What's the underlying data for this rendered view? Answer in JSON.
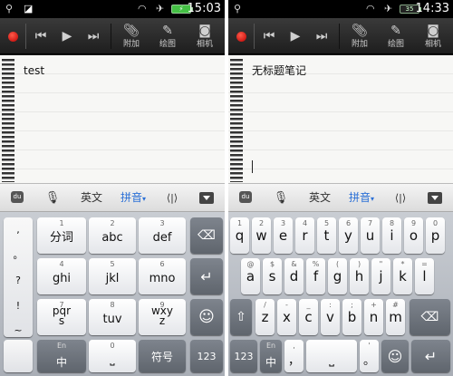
{
  "left_screen": {
    "status": {
      "time": "15:03",
      "icons": [
        "usb-icon",
        "debug-icon",
        "wifi-icon",
        "airplane-icon",
        "battery-full-icon"
      ]
    },
    "toolbar": {
      "attach_label": "附加",
      "draw_label": "绘图",
      "camera_label": "相机"
    },
    "note": {
      "text": "test"
    },
    "ime_bar": {
      "english": "英文",
      "pinyin": "拼音",
      "pinyin_caret": "▾",
      "cursor_glyph": "⟨|⟩"
    },
    "keyboard": {
      "layout": "nine-key",
      "left_column": [
        ",",
        "。",
        "?",
        "!",
        "~"
      ],
      "keys": [
        {
          "sup": "1",
          "main": "分词"
        },
        {
          "sup": "2",
          "main": "abc"
        },
        {
          "sup": "3",
          "main": "def"
        },
        {
          "sup": "4",
          "main": "ghi"
        },
        {
          "sup": "5",
          "main": "jkl"
        },
        {
          "sup": "6",
          "main": "mno"
        },
        {
          "sup": "7",
          "main": "pqr\ns"
        },
        {
          "sup": "8",
          "main": "tuv"
        },
        {
          "sup": "9",
          "main": "wxy\nz"
        }
      ],
      "lang_key": {
        "sup": "En",
        "main": "中"
      },
      "space_key": {
        "sup": "0",
        "main": "⎵"
      },
      "symbol_key": "符号",
      "number_key": "123"
    }
  },
  "right_screen": {
    "status": {
      "time": "14:33",
      "battery_percent": "35",
      "icons": [
        "usb-icon",
        "wifi-icon",
        "airplane-icon",
        "battery-icon"
      ]
    },
    "toolbar": {
      "attach_label": "附加",
      "draw_label": "绘图",
      "camera_label": "相机"
    },
    "note": {
      "text": "无标题笔记"
    },
    "ime_bar": {
      "english": "英文",
      "pinyin": "拼音",
      "pinyin_caret": "▾",
      "cursor_glyph": "⟨|⟩"
    },
    "keyboard": {
      "layout": "qwerty",
      "rows": [
        [
          {
            "sup": "1",
            "main": "q"
          },
          {
            "sup": "2",
            "main": "w"
          },
          {
            "sup": "3",
            "main": "e"
          },
          {
            "sup": "4",
            "main": "r"
          },
          {
            "sup": "5",
            "main": "t"
          },
          {
            "sup": "6",
            "main": "y"
          },
          {
            "sup": "7",
            "main": "u"
          },
          {
            "sup": "8",
            "main": "i"
          },
          {
            "sup": "9",
            "main": "o"
          },
          {
            "sup": "0",
            "main": "p"
          }
        ],
        [
          {
            "sup": "@",
            "main": "a"
          },
          {
            "sup": "$",
            "main": "s"
          },
          {
            "sup": "&",
            "main": "d"
          },
          {
            "sup": "%",
            "main": "f"
          },
          {
            "sup": "(",
            "main": "g"
          },
          {
            "sup": ")",
            "main": "h"
          },
          {
            "sup": "\"",
            "main": "j"
          },
          {
            "sup": "*",
            "main": "k"
          },
          {
            "sup": "=",
            "main": "l"
          }
        ],
        [
          {
            "sup": "/",
            "main": "z"
          },
          {
            "sup": "-",
            "main": "x"
          },
          {
            "sup": "_",
            "main": "c"
          },
          {
            "sup": ":",
            "main": "v"
          },
          {
            "sup": ";",
            "main": "b"
          },
          {
            "sup": "+",
            "main": "n"
          },
          {
            "sup": "#",
            "main": "m"
          }
        ]
      ],
      "comma_key": {
        "sup": ",",
        "main": "，"
      },
      "period_key": {
        "sup": "'",
        "main": "。"
      },
      "lang_key": {
        "sup": "En",
        "main": "中"
      },
      "space_key": "⎵",
      "number_key": "123",
      "emoji_key": "☺"
    }
  },
  "colors": {
    "record_red": "#e02818",
    "ime_active_blue": "#2a6fd6",
    "key_dark": "#6b7179"
  }
}
